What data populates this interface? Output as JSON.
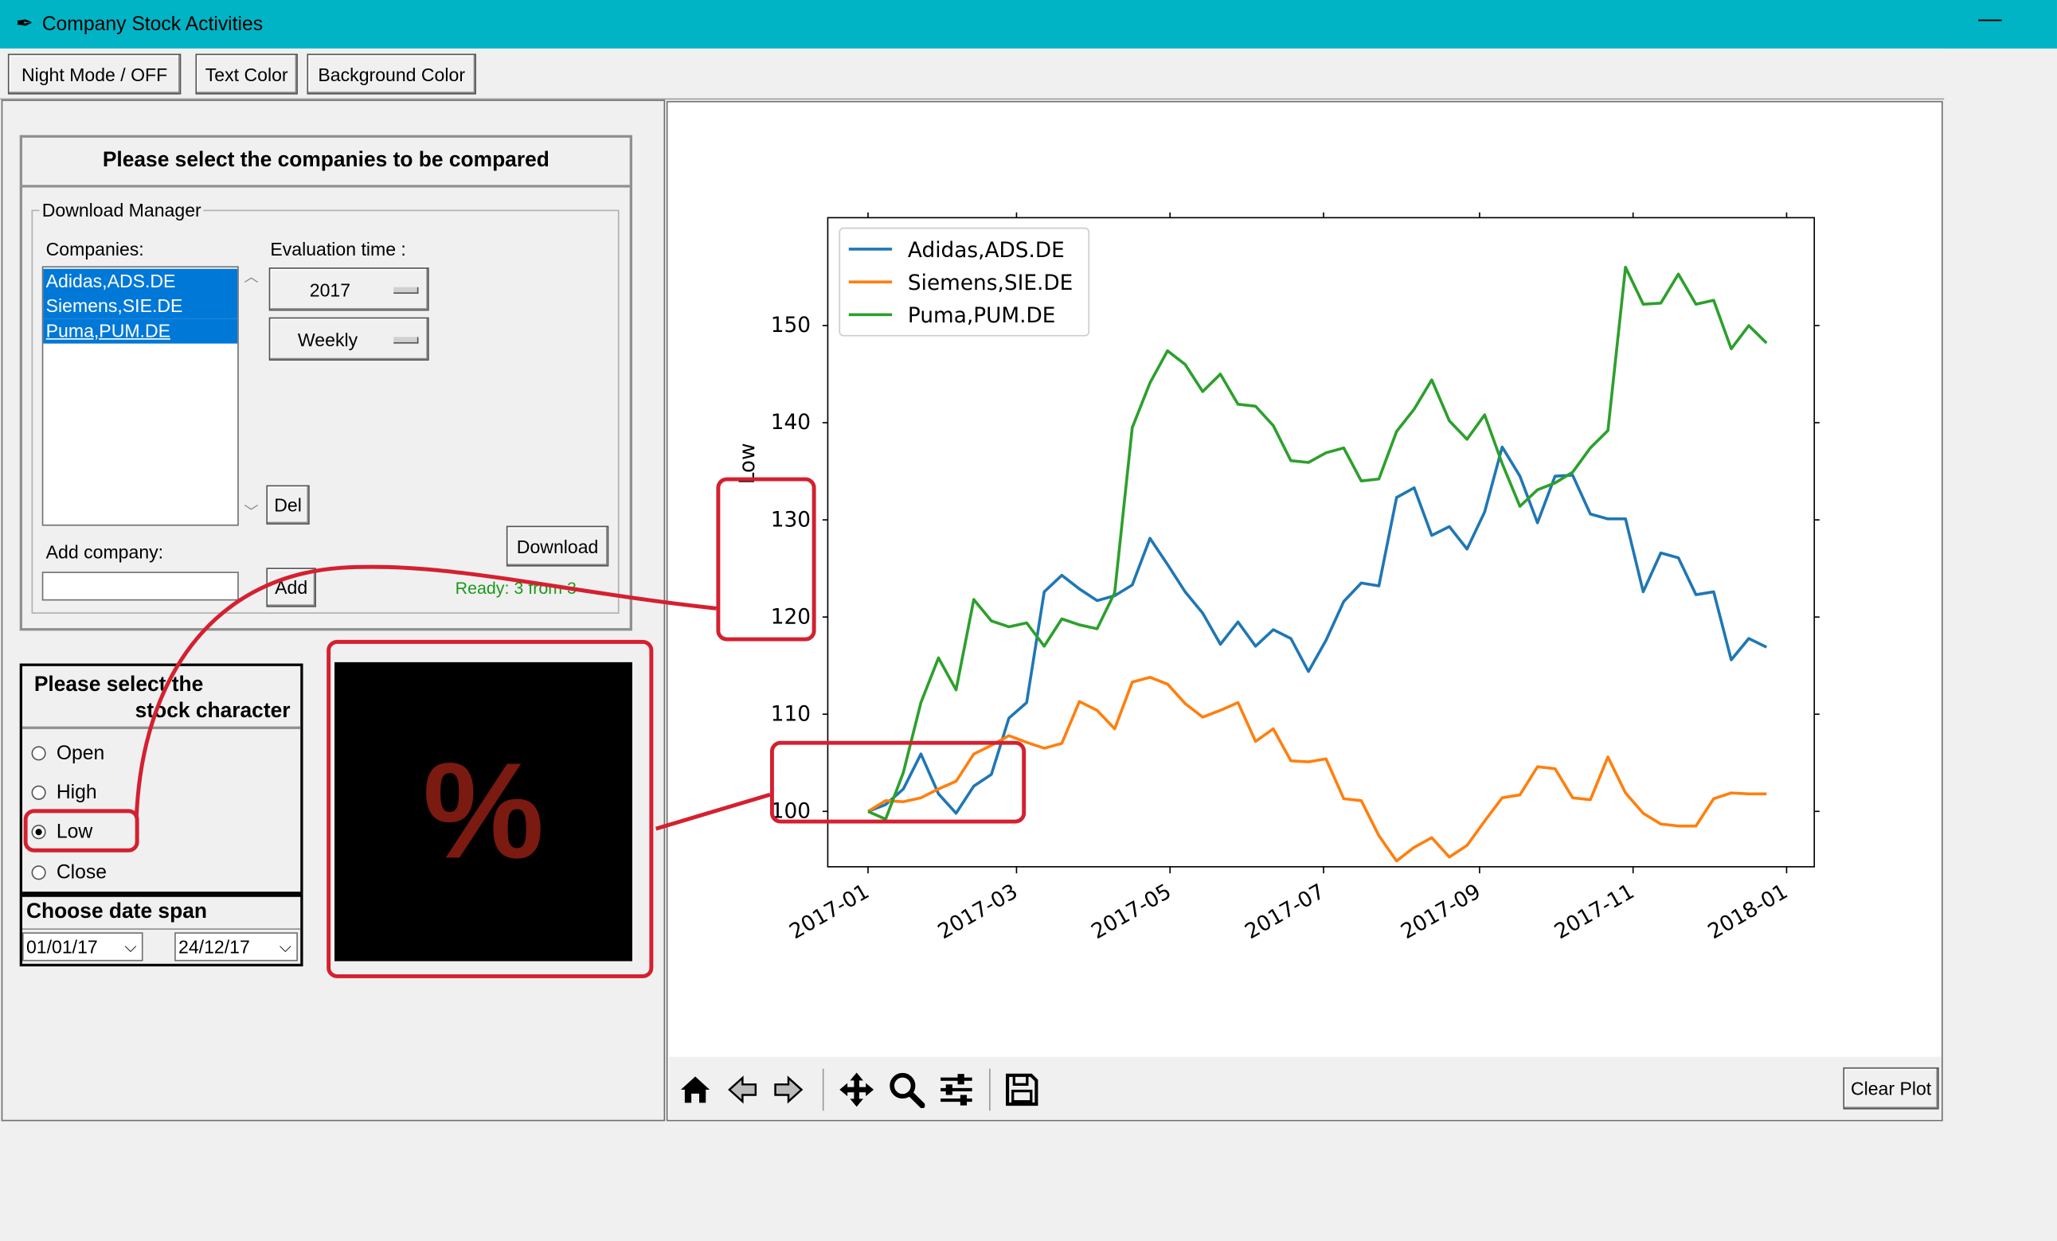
{
  "window": {
    "title": "Company Stock Activities",
    "minimize": "—"
  },
  "toolbar": {
    "night_mode": "Night Mode / OFF",
    "text_color": "Text Color",
    "background_color": "Background Color"
  },
  "companies_panel": {
    "header": "Please select the companies to be compared",
    "download_manager_label": "Download Manager",
    "companies_label": "Companies:",
    "companies": [
      "Adidas,ADS.DE",
      "Siemens,SIE.DE",
      "Puma,PUM.DE"
    ],
    "evaluation_label": "Evaluation time :",
    "year": "2017",
    "interval": "Weekly",
    "del_button": "Del",
    "download_button": "Download",
    "add_company_label": "Add company:",
    "add_company_value": "",
    "add_button": "Add",
    "status": "Ready: 3 from 3",
    "status_color": "#1a9a1a"
  },
  "stock_character": {
    "header_line1": "Please select the",
    "header_line2": "stock character",
    "options": [
      "Open",
      "High",
      "Low",
      "Close"
    ],
    "selected": "Low"
  },
  "date_span": {
    "header": "Choose date span",
    "from": "01/01/17",
    "to": "24/12/17"
  },
  "percent_toggle": {
    "symbol": "%",
    "color": "#7a1a10"
  },
  "plot_toolbar": {
    "icons": [
      "home-icon",
      "back-arrow-icon",
      "forward-arrow-icon",
      "pan-icon",
      "zoom-icon",
      "configure-icon",
      "save-icon"
    ],
    "clear_plot": "Clear Plot"
  },
  "chart_data": {
    "type": "line",
    "ylabel": "Low",
    "xlabel": "",
    "title": "",
    "x_ticks": [
      "2017-01",
      "2017-03",
      "2017-05",
      "2017-07",
      "2017-09",
      "2017-11",
      "2018-01"
    ],
    "y_ticks": [
      100,
      110,
      120,
      130,
      140,
      150
    ],
    "xlim": [
      "2016-12-16",
      "2018-01-12"
    ],
    "ylim": [
      94.3,
      161.1
    ],
    "legend_position": "top-left",
    "series": [
      {
        "name": "Adidas,ADS.DE",
        "color": "#1f77b4",
        "x": [
          "2017-01-01",
          "2017-01-08",
          "2017-01-15",
          "2017-01-22",
          "2017-01-29",
          "2017-02-05",
          "2017-02-12",
          "2017-02-19",
          "2017-02-26",
          "2017-03-05",
          "2017-03-12",
          "2017-03-19",
          "2017-03-26",
          "2017-04-02",
          "2017-04-09",
          "2017-04-16",
          "2017-04-23",
          "2017-04-30",
          "2017-05-07",
          "2017-05-14",
          "2017-05-21",
          "2017-05-28",
          "2017-06-04",
          "2017-06-11",
          "2017-06-18",
          "2017-06-25",
          "2017-07-02",
          "2017-07-09",
          "2017-07-16",
          "2017-07-23",
          "2017-07-30",
          "2017-08-06",
          "2017-08-13",
          "2017-08-20",
          "2017-08-27",
          "2017-09-03",
          "2017-09-10",
          "2017-09-17",
          "2017-09-24",
          "2017-10-01",
          "2017-10-08",
          "2017-10-15",
          "2017-10-22",
          "2017-10-29",
          "2017-11-05",
          "2017-11-12",
          "2017-11-19",
          "2017-11-26",
          "2017-12-03",
          "2017-12-10",
          "2017-12-17",
          "2017-12-24"
        ],
        "values": [
          100.0,
          100.7,
          102.3,
          105.9,
          101.8,
          99.8,
          102.6,
          103.8,
          109.6,
          111.2,
          122.6,
          124.3,
          122.9,
          121.7,
          122.2,
          123.3,
          128.1,
          125.4,
          122.6,
          120.4,
          117.2,
          119.5,
          117.0,
          118.7,
          117.8,
          114.4,
          117.6,
          121.6,
          123.5,
          123.2,
          132.3,
          133.3,
          128.4,
          129.3,
          127.0,
          130.8,
          137.5,
          134.5,
          129.7,
          134.5,
          134.6,
          130.6,
          130.1,
          130.1,
          122.6,
          126.6,
          126.1,
          122.3,
          122.6,
          115.6,
          117.8,
          116.9
        ]
      },
      {
        "name": "Siemens,SIE.DE",
        "color": "#ff7f0e",
        "x": [
          "2017-01-01",
          "2017-01-08",
          "2017-01-15",
          "2017-01-22",
          "2017-01-29",
          "2017-02-05",
          "2017-02-12",
          "2017-02-19",
          "2017-02-26",
          "2017-03-05",
          "2017-03-12",
          "2017-03-19",
          "2017-03-26",
          "2017-04-02",
          "2017-04-09",
          "2017-04-16",
          "2017-04-23",
          "2017-04-30",
          "2017-05-07",
          "2017-05-14",
          "2017-05-21",
          "2017-05-28",
          "2017-06-04",
          "2017-06-11",
          "2017-06-18",
          "2017-06-25",
          "2017-07-02",
          "2017-07-09",
          "2017-07-16",
          "2017-07-23",
          "2017-07-30",
          "2017-08-06",
          "2017-08-13",
          "2017-08-20",
          "2017-08-27",
          "2017-09-03",
          "2017-09-10",
          "2017-09-17",
          "2017-09-24",
          "2017-10-01",
          "2017-10-08",
          "2017-10-15",
          "2017-10-22",
          "2017-10-29",
          "2017-11-05",
          "2017-11-12",
          "2017-11-19",
          "2017-11-26",
          "2017-12-03",
          "2017-12-10",
          "2017-12-17",
          "2017-12-24"
        ],
        "values": [
          100.0,
          101.1,
          101.0,
          101.4,
          102.3,
          103.1,
          105.9,
          106.8,
          107.8,
          107.1,
          106.5,
          107.0,
          111.3,
          110.4,
          108.5,
          113.3,
          113.8,
          113.1,
          111.1,
          109.7,
          110.4,
          111.2,
          107.2,
          108.5,
          105.2,
          105.1,
          105.4,
          101.3,
          101.1,
          97.5,
          94.9,
          96.3,
          97.3,
          95.3,
          96.5,
          99.0,
          101.4,
          101.7,
          104.6,
          104.4,
          101.4,
          101.2,
          105.6,
          101.9,
          99.8,
          98.7,
          98.5,
          98.5,
          101.3,
          101.9,
          101.8,
          101.8
        ]
      },
      {
        "name": "Puma,PUM.DE",
        "color": "#2ca02c",
        "x": [
          "2017-01-01",
          "2017-01-08",
          "2017-01-15",
          "2017-01-22",
          "2017-01-29",
          "2017-02-05",
          "2017-02-12",
          "2017-02-19",
          "2017-02-26",
          "2017-03-05",
          "2017-03-12",
          "2017-03-19",
          "2017-03-26",
          "2017-04-02",
          "2017-04-09",
          "2017-04-16",
          "2017-04-23",
          "2017-04-30",
          "2017-05-07",
          "2017-05-14",
          "2017-05-21",
          "2017-05-28",
          "2017-06-04",
          "2017-06-11",
          "2017-06-18",
          "2017-06-25",
          "2017-07-02",
          "2017-07-09",
          "2017-07-16",
          "2017-07-23",
          "2017-07-30",
          "2017-08-06",
          "2017-08-13",
          "2017-08-20",
          "2017-08-27",
          "2017-09-03",
          "2017-09-10",
          "2017-09-17",
          "2017-09-24",
          "2017-10-01",
          "2017-10-08",
          "2017-10-15",
          "2017-10-22",
          "2017-10-29",
          "2017-11-05",
          "2017-11-12",
          "2017-11-19",
          "2017-11-26",
          "2017-12-03",
          "2017-12-10",
          "2017-12-17",
          "2017-12-24"
        ],
        "values": [
          100.0,
          99.2,
          104.0,
          111.2,
          115.8,
          112.5,
          121.8,
          119.6,
          119.0,
          119.4,
          117.0,
          119.8,
          119.2,
          118.8,
          122.5,
          139.5,
          144.1,
          147.4,
          146.0,
          143.2,
          145.0,
          141.9,
          141.7,
          139.7,
          136.1,
          135.9,
          136.9,
          137.4,
          134.0,
          134.2,
          139.1,
          141.4,
          144.4,
          140.2,
          138.3,
          140.8,
          135.8,
          131.4,
          133.1,
          133.8,
          134.9,
          137.4,
          139.2,
          156.0,
          152.2,
          152.3,
          155.3,
          152.2,
          152.6,
          147.6,
          150.0,
          148.2
        ]
      }
    ]
  }
}
